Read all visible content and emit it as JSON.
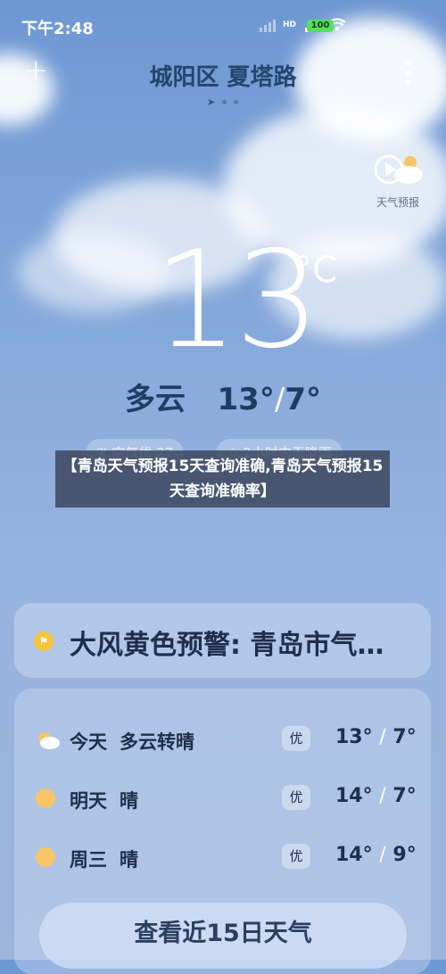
{
  "status_bar": {
    "time": "下午2:48",
    "network": "HD",
    "battery": "100"
  },
  "header": {
    "location": "城阳区 夏塔路"
  },
  "forecast_video": {
    "label": "天气预报"
  },
  "current": {
    "temperature": "13",
    "unit": "°C",
    "condition_line": "多云",
    "high": "13°",
    "low": "7°"
  },
  "chips": {
    "air_quality": "空气优 27",
    "rain": "2小时内无降雨"
  },
  "banner": {
    "text": "【青岛天气预报15天查询准确,青岛天气预报15天查询准确率】"
  },
  "alert": {
    "text": "大风黄色预警: 青岛市气…"
  },
  "daily": [
    {
      "day": "今天",
      "condition": "多云转晴",
      "aqi": "优",
      "high": "13°",
      "low": "7°"
    },
    {
      "day": "明天",
      "condition": "晴",
      "aqi": "优",
      "high": "14°",
      "low": "7°"
    },
    {
      "day": "周三",
      "condition": "晴",
      "aqi": "优",
      "high": "14°",
      "low": "9°"
    }
  ],
  "cta": {
    "label": "查看近15日天气"
  },
  "colors": {
    "sky": "#6e98d3",
    "sun": "#f7c565",
    "alert": "#f4c63b"
  }
}
